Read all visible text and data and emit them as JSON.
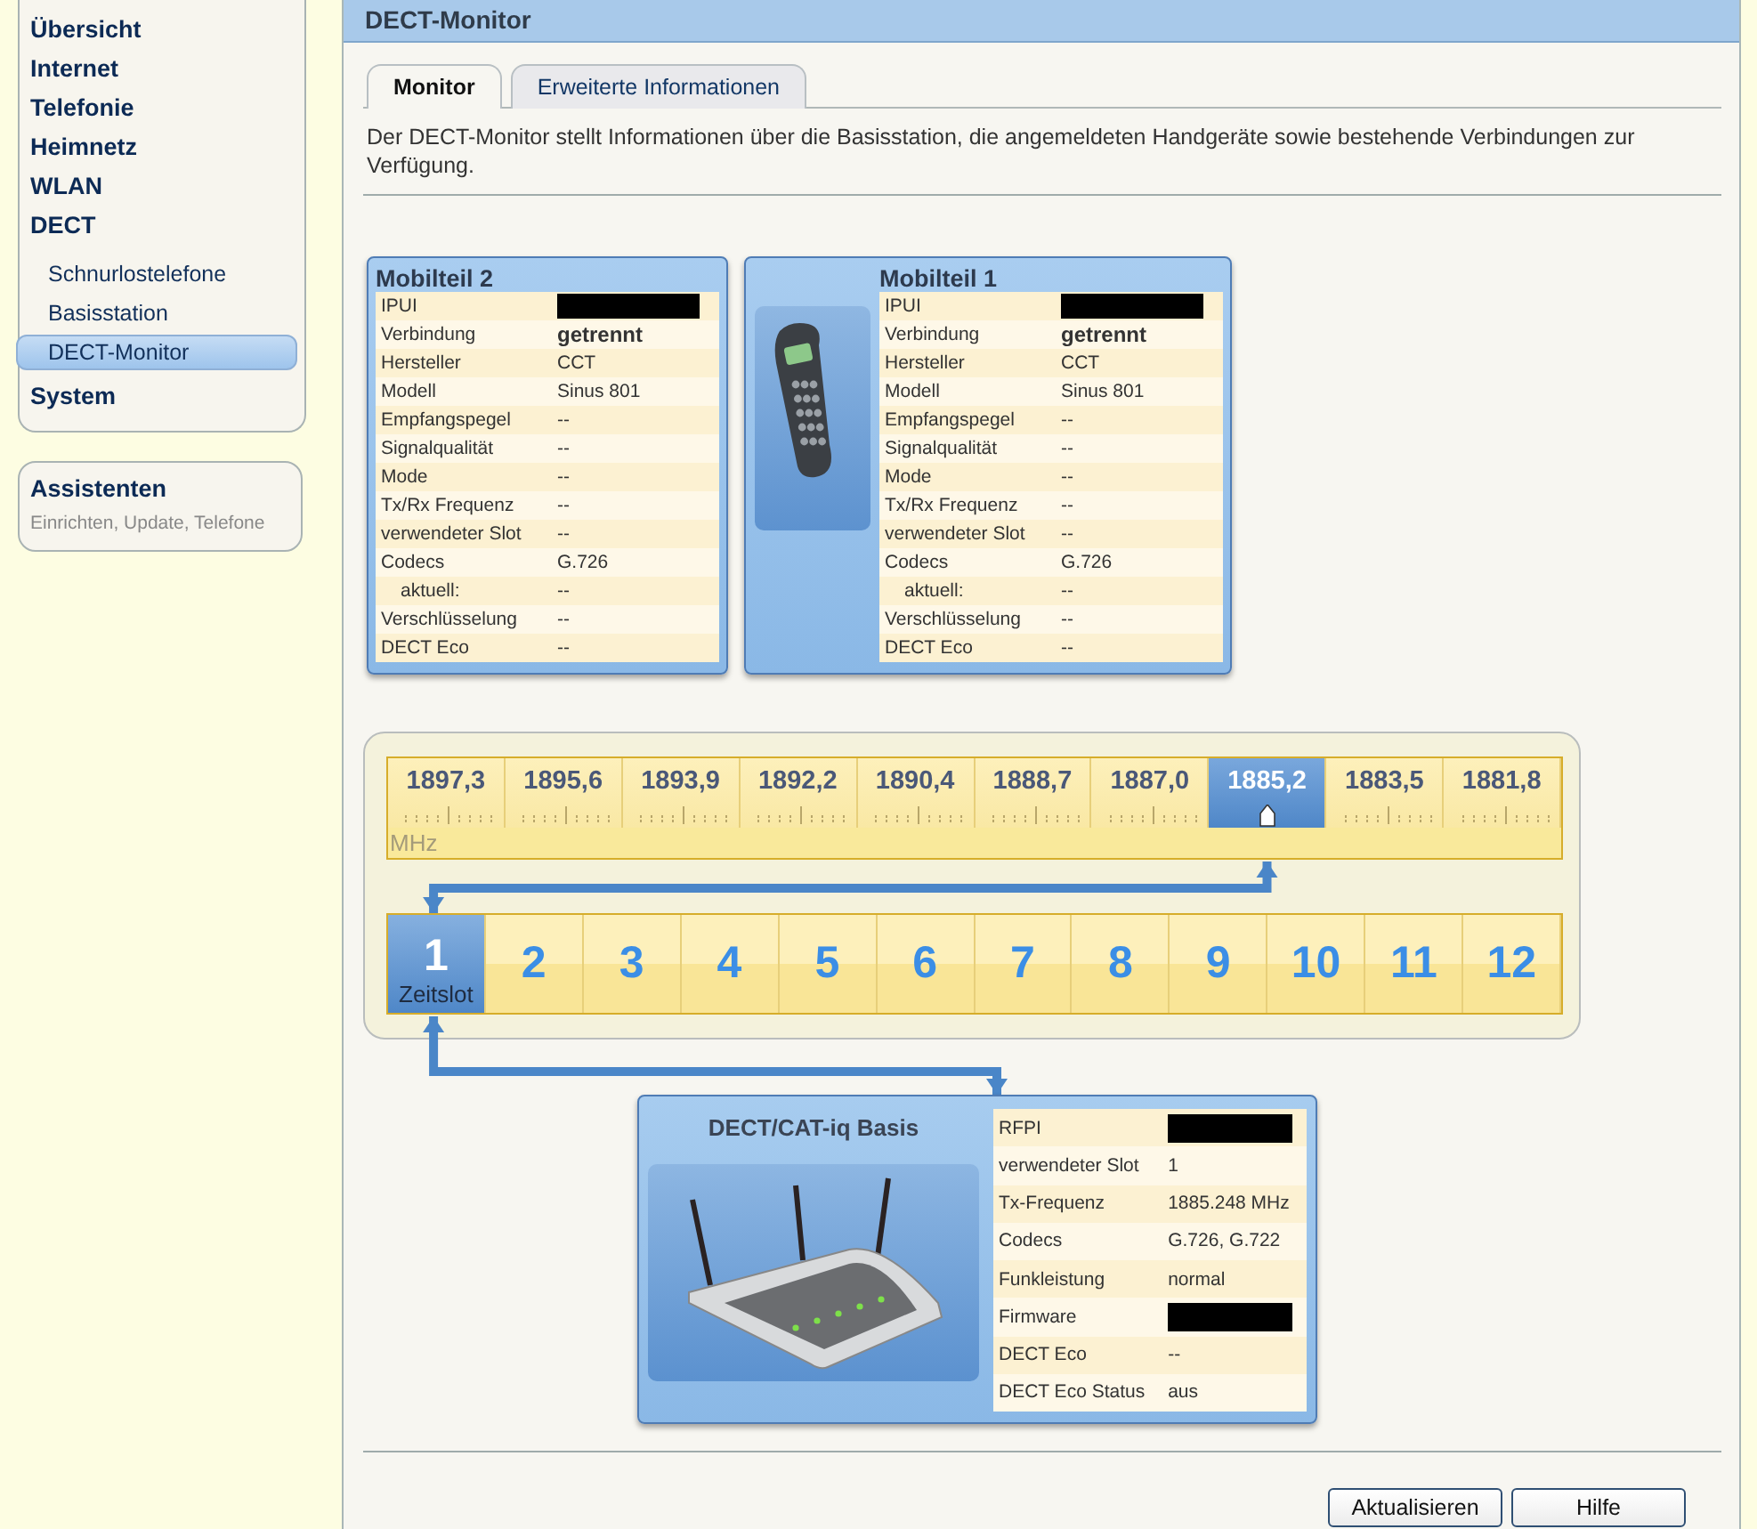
{
  "sidebar": {
    "items": [
      {
        "label": "Übersicht",
        "selected": false
      },
      {
        "label": "Internet",
        "selected": false
      },
      {
        "label": "Telefonie",
        "selected": false
      },
      {
        "label": "Heimnetz",
        "selected": false
      },
      {
        "label": "WLAN",
        "selected": false
      },
      {
        "label": "DECT",
        "selected": false,
        "children": [
          {
            "label": "Schnurlostelefone",
            "selected": false
          },
          {
            "label": "Basisstation",
            "selected": false
          },
          {
            "label": "DECT-Monitor",
            "selected": true
          }
        ]
      },
      {
        "label": "System",
        "selected": false
      }
    ]
  },
  "assistants": {
    "title": "Assistenten",
    "subtitle": "Einrichten, Update, Telefone"
  },
  "panel": {
    "title": "DECT-Monitor",
    "tabs": [
      {
        "label": "Monitor",
        "selected": true
      },
      {
        "label": "Erweiterte Informationen",
        "selected": false
      }
    ],
    "description": "Der DECT-Monitor stellt Informationen über die Basisstation, die angemeldeten Handgeräte sowie bestehende Verbindungen zur Verfügung."
  },
  "handsets": [
    {
      "name": "Mobilteil 2",
      "picture": false,
      "rows": [
        {
          "label": "IPUI",
          "kind": "redacted"
        },
        {
          "label": "Verbindung",
          "value": "getrennt",
          "kind": "bold"
        },
        {
          "label": "Hersteller",
          "value": "CCT",
          "kind": "plain"
        },
        {
          "label": "Modell",
          "value": "Sinus 801",
          "kind": "plain"
        },
        {
          "label": "Empfangspegel",
          "value": "--",
          "kind": "plain"
        },
        {
          "label": "Signalqualität",
          "value": "--",
          "kind": "plain"
        },
        {
          "label": "Mode",
          "value": "--",
          "kind": "plain"
        },
        {
          "label": "Tx/Rx Frequenz",
          "value": "--",
          "kind": "plain"
        },
        {
          "label": "verwendeter Slot",
          "value": "--",
          "kind": "plain"
        },
        {
          "label": "Codecs",
          "value": "G.726",
          "kind": "plain"
        },
        {
          "label": "aktuell:",
          "value": "--",
          "kind": "sub"
        },
        {
          "label": "Verschlüsselung",
          "value": "--",
          "kind": "plain"
        },
        {
          "label": "DECT Eco",
          "value": "--",
          "kind": "plain"
        }
      ]
    },
    {
      "name": "Mobilteil 1",
      "picture": true,
      "rows": [
        {
          "label": "IPUI",
          "kind": "redacted"
        },
        {
          "label": "Verbindung",
          "value": "getrennt",
          "kind": "bold"
        },
        {
          "label": "Hersteller",
          "value": "CCT",
          "kind": "plain"
        },
        {
          "label": "Modell",
          "value": "Sinus 801",
          "kind": "plain"
        },
        {
          "label": "Empfangspegel",
          "value": "--",
          "kind": "plain"
        },
        {
          "label": "Signalqualität",
          "value": "--",
          "kind": "plain"
        },
        {
          "label": "Mode",
          "value": "--",
          "kind": "plain"
        },
        {
          "label": "Tx/Rx Frequenz",
          "value": "--",
          "kind": "plain"
        },
        {
          "label": "verwendeter Slot",
          "value": "--",
          "kind": "plain"
        },
        {
          "label": "Codecs",
          "value": "G.726",
          "kind": "plain"
        },
        {
          "label": "aktuell:",
          "value": "--",
          "kind": "sub"
        },
        {
          "label": "Verschlüsselung",
          "value": "--",
          "kind": "plain"
        },
        {
          "label": "DECT Eco",
          "value": "--",
          "kind": "plain"
        }
      ]
    }
  ],
  "frequencies": {
    "unit": "MHz",
    "channels": [
      {
        "label": "1897,3",
        "selected": false
      },
      {
        "label": "1895,6",
        "selected": false
      },
      {
        "label": "1893,9",
        "selected": false
      },
      {
        "label": "1892,2",
        "selected": false
      },
      {
        "label": "1890,4",
        "selected": false
      },
      {
        "label": "1888,7",
        "selected": false
      },
      {
        "label": "1887,0",
        "selected": false
      },
      {
        "label": "1885,2",
        "selected": true
      },
      {
        "label": "1883,5",
        "selected": false
      },
      {
        "label": "1881,8",
        "selected": false
      }
    ]
  },
  "timeslots": {
    "unit": "Zeitslot",
    "slots": [
      {
        "label": "1",
        "selected": true
      },
      {
        "label": "2",
        "selected": false
      },
      {
        "label": "3",
        "selected": false
      },
      {
        "label": "4",
        "selected": false
      },
      {
        "label": "5",
        "selected": false
      },
      {
        "label": "6",
        "selected": false
      },
      {
        "label": "7",
        "selected": false
      },
      {
        "label": "8",
        "selected": false
      },
      {
        "label": "9",
        "selected": false
      },
      {
        "label": "10",
        "selected": false
      },
      {
        "label": "11",
        "selected": false
      },
      {
        "label": "12",
        "selected": false
      }
    ]
  },
  "base": {
    "title": "DECT/CAT-iq Basis",
    "rows": [
      {
        "label": "RFPI",
        "kind": "redacted"
      },
      {
        "label": "verwendeter Slot",
        "value": "1",
        "kind": "plain"
      },
      {
        "label": "Tx-Frequenz",
        "value": "1885.248 MHz",
        "kind": "plain"
      },
      {
        "label": "Codecs",
        "value": "G.726, G.722",
        "kind": "plain"
      },
      {
        "label": "Funkleistung",
        "value": "normal",
        "kind": "plain"
      },
      {
        "label": "Firmware",
        "kind": "redacted"
      },
      {
        "label": "DECT Eco",
        "value": "--",
        "kind": "plain"
      },
      {
        "label": "DECT Eco Status",
        "value": "aus",
        "kind": "plain"
      }
    ]
  },
  "buttons": [
    "Aktualisieren",
    "Hilfe"
  ]
}
